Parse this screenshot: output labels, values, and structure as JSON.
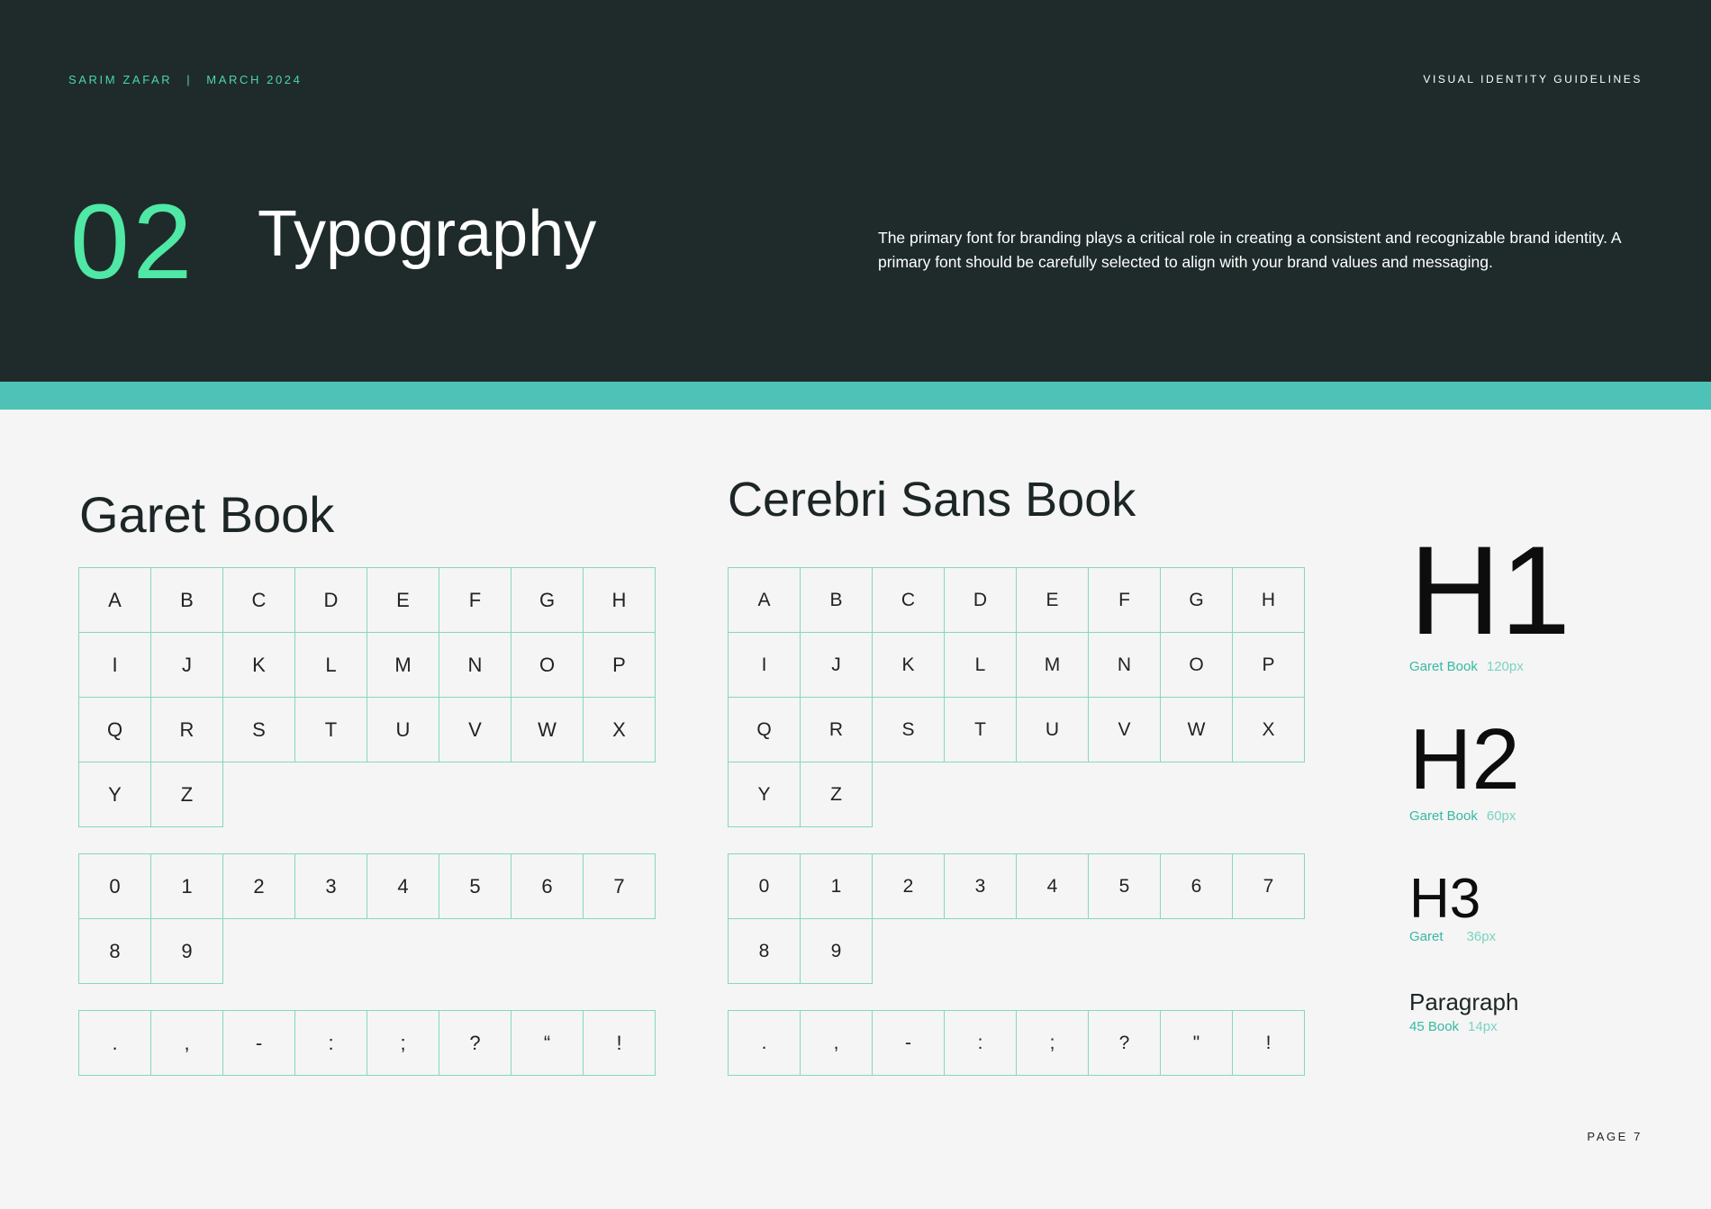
{
  "header": {
    "author": "SARIM ZAFAR",
    "separator": "|",
    "date": "MARCH 2024",
    "doc_title": "VISUAL IDENTITY GUIDELINES",
    "section_number": "02",
    "section_title": "Typography",
    "description": "The primary font for branding plays a critical role in creating a consistent and recognizable brand identity. A primary font should be carefully selected to align with your brand values and messaging."
  },
  "fonts": [
    {
      "name": "Garet Book",
      "letters": [
        "A",
        "B",
        "C",
        "D",
        "E",
        "F",
        "G",
        "H",
        "I",
        "J",
        "K",
        "L",
        "M",
        "N",
        "O",
        "P",
        "Q",
        "R",
        "S",
        "T",
        "U",
        "V",
        "W",
        "X",
        "Y",
        "Z"
      ],
      "digits": [
        "0",
        "1",
        "2",
        "3",
        "4",
        "5",
        "6",
        "7",
        "8",
        "9"
      ],
      "punctuation": [
        ".",
        ",",
        "-",
        ":",
        ";",
        "?",
        "“",
        "!"
      ]
    },
    {
      "name": "Cerebri Sans Book",
      "letters": [
        "A",
        "B",
        "C",
        "D",
        "E",
        "F",
        "G",
        "H",
        "I",
        "J",
        "K",
        "L",
        "M",
        "N",
        "O",
        "P",
        "Q",
        "R",
        "S",
        "T",
        "U",
        "V",
        "W",
        "X",
        "Y",
        "Z"
      ],
      "digits": [
        "0",
        "1",
        "2",
        "3",
        "4",
        "5",
        "6",
        "7",
        "8",
        "9"
      ],
      "punctuation": [
        ".",
        ",",
        "-",
        ":",
        ";",
        "?",
        "\"",
        "!"
      ]
    }
  ],
  "specs": [
    {
      "label": "H1",
      "font": "Garet Book",
      "size": "120px"
    },
    {
      "label": "H2",
      "font": "Garet Book",
      "size": "60px"
    },
    {
      "label": "H3",
      "font": "Garet",
      "size": "36px"
    },
    {
      "label": "Paragraph",
      "font": "45 Book",
      "size": "14px"
    }
  ],
  "footer": {
    "page": "PAGE 7"
  },
  "colors": {
    "header_bg": "#1f2b2b",
    "accent_green": "#4fe8a5",
    "band_teal": "#4fc2b7",
    "grid_border": "#86d8bd",
    "spec_label": "#38b8a5"
  }
}
